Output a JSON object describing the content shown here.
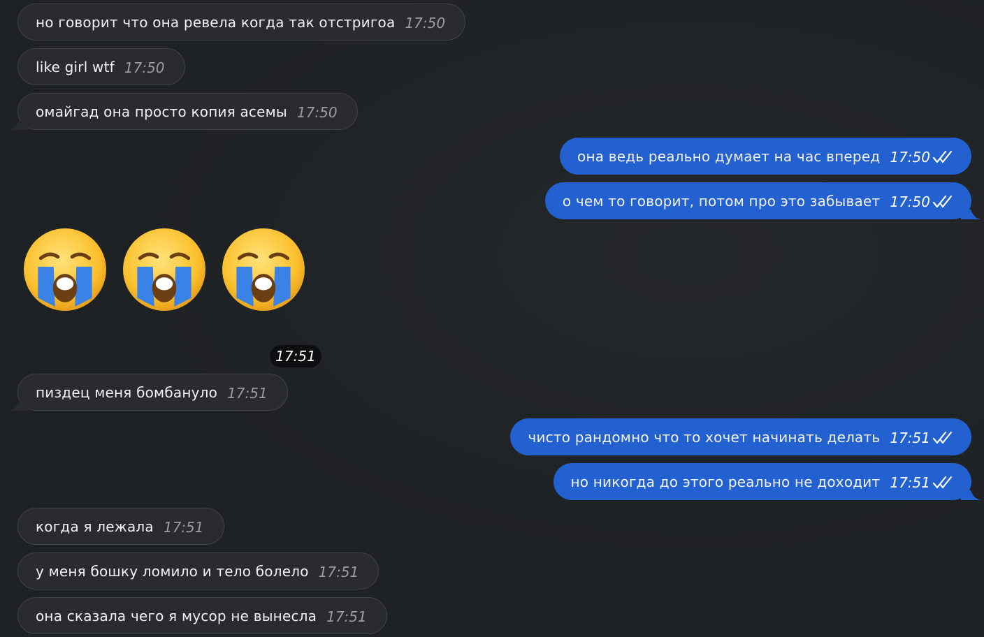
{
  "colors": {
    "background": "#1f2225",
    "incoming_bubble": "#292b2f",
    "outgoing_bubble": "#2361d1",
    "incoming_time": "#9a9da2"
  },
  "messages": [
    {
      "text": "но говорит что она ревела когда так отстригоа",
      "time": "17:50",
      "direction": "incoming"
    },
    {
      "text": "like girl wtf",
      "time": "17:50",
      "direction": "incoming"
    },
    {
      "text": "омайгад она просто копия асемы",
      "time": "17:50",
      "direction": "incoming"
    },
    {
      "text": "она ведь реально думает на час вперед",
      "time": "17:50",
      "direction": "outgoing",
      "status": "read"
    },
    {
      "text": "о чем то говорит, потом про это забывает",
      "time": "17:50",
      "direction": "outgoing",
      "status": "read"
    },
    {
      "text": "пиздец меня бомбануло",
      "time": "17:51",
      "direction": "incoming"
    },
    {
      "text": "чисто рандомно что то хочет начинать делать",
      "time": "17:51",
      "direction": "outgoing",
      "status": "read"
    },
    {
      "text": "но никогда до этого реально не доходит",
      "time": "17:51",
      "direction": "outgoing",
      "status": "read"
    },
    {
      "text": "когда я лежала",
      "time": "17:51",
      "direction": "incoming"
    },
    {
      "text": "у меня бошку ломило и тело болело",
      "time": "17:51",
      "direction": "incoming"
    },
    {
      "text": "она сказала чего я мусор не вынесла",
      "time": "17:51",
      "direction": "incoming"
    }
  ],
  "emoji_message": {
    "emojis": [
      "loudly-crying-face",
      "loudly-crying-face",
      "loudly-crying-face"
    ],
    "time": "17:51",
    "direction": "incoming"
  }
}
